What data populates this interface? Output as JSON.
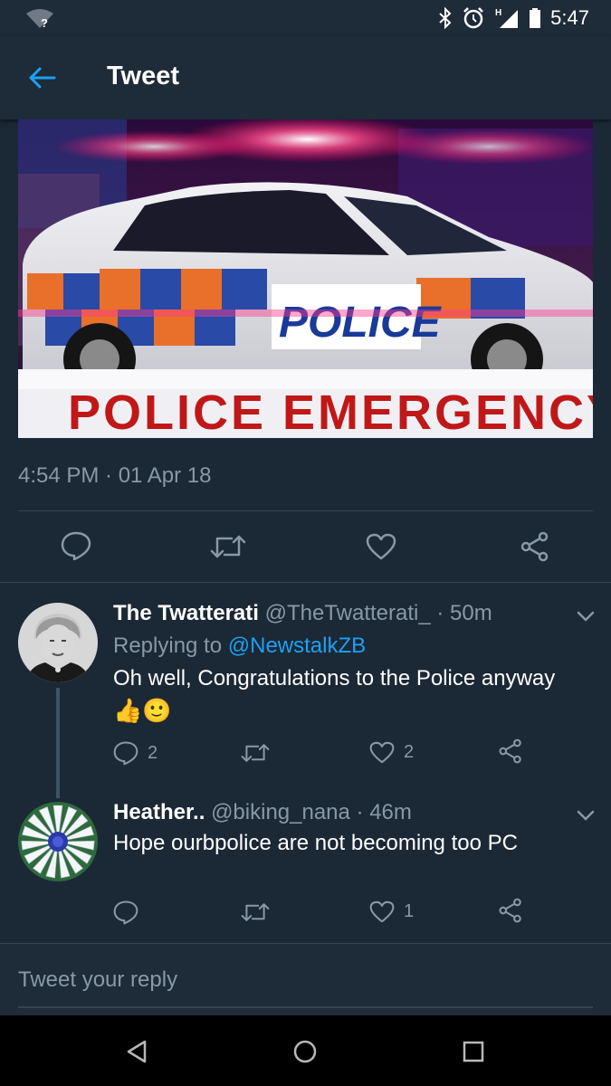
{
  "status_bar": {
    "time": "5:47",
    "wifi_badge": "?",
    "network_type": "H",
    "icons": [
      "wifi-question-icon",
      "bluetooth-icon",
      "alarm-icon",
      "signal-icon",
      "battery-icon"
    ]
  },
  "app_bar": {
    "title": "Tweet",
    "back_icon": "arrow-left-icon"
  },
  "tweet": {
    "media_banner_text": "POLICE EMERGENCY",
    "car_livery_text": "POLICE",
    "timestamp": "4:54 PM · 01 Apr 18",
    "actions": [
      "reply-icon",
      "retweet-icon",
      "like-icon",
      "share-icon"
    ]
  },
  "replies": [
    {
      "name": "The Twatterati",
      "handle": "@TheTwatterati_",
      "time": "· 50m",
      "replying_prefix": "Replying to",
      "replying_to": "@NewstalkZB",
      "text": "Oh well, Congratulations to the Police anyway",
      "emoji": "👍🙂",
      "reply_count": "2",
      "retweet_count": "",
      "like_count": "2"
    },
    {
      "name": "Heather..",
      "handle": "@biking_nana",
      "time": "· 46m",
      "text": "Hope ourbpolice are not becoming too PC",
      "reply_count": "",
      "retweet_count": "",
      "like_count": "1"
    }
  ],
  "compose": {
    "placeholder": "Tweet your reply"
  },
  "nav_bar": {
    "buttons": [
      "back-triangle-icon",
      "home-circle-icon",
      "recents-square-icon"
    ]
  },
  "colors": {
    "background": "#1b2836",
    "accent": "#1da1f2",
    "muted": "#8899a6",
    "divider": "#38444d"
  }
}
